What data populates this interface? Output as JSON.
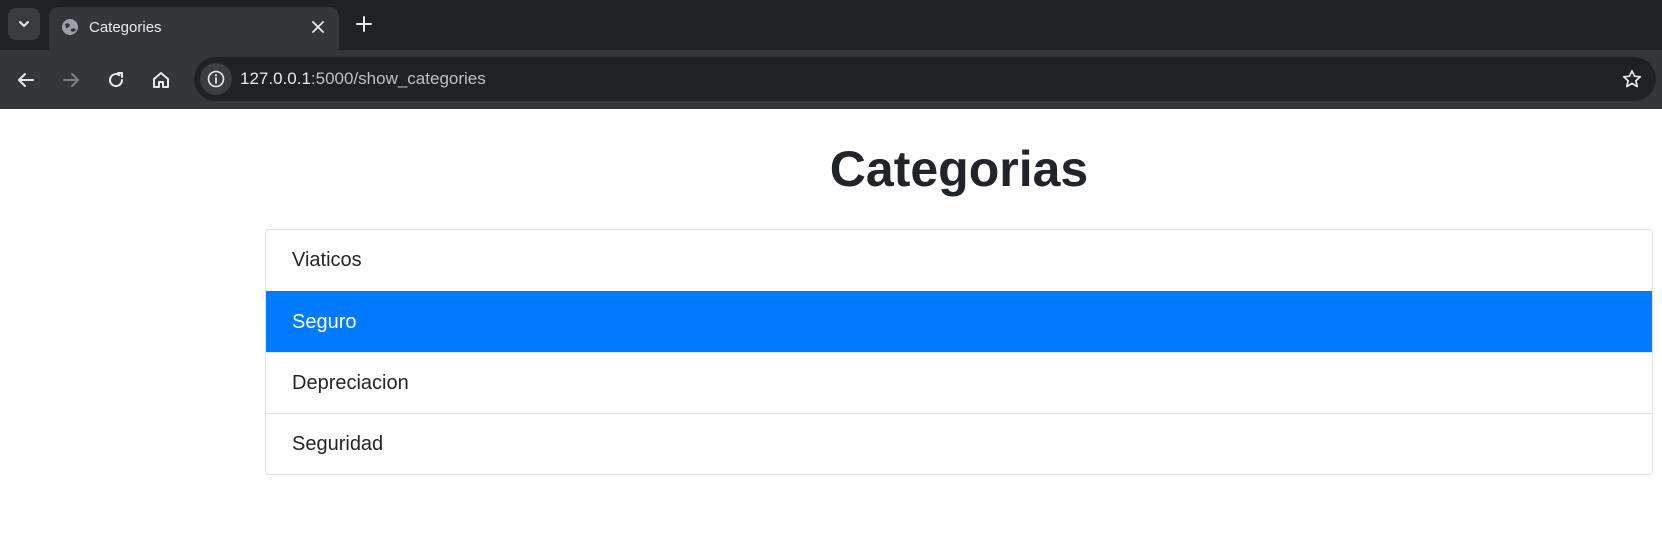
{
  "browser": {
    "tab": {
      "title": "Categories"
    },
    "address_bar": {
      "host": "127.0.0.1",
      "rest": ":5000/show_categories"
    },
    "icons": [
      "chevron-down-icon",
      "globe-icon",
      "close-icon",
      "plus-icon",
      "back-arrow-icon",
      "forward-arrow-icon",
      "reload-icon",
      "home-icon",
      "info-icon",
      "star-icon"
    ]
  },
  "page": {
    "title": "Categorias",
    "categories": [
      {
        "label": "Viaticos",
        "active": false
      },
      {
        "label": "Seguro",
        "active": true
      },
      {
        "label": "Depreciacion",
        "active": false
      },
      {
        "label": "Seguridad",
        "active": false
      }
    ]
  },
  "colors": {
    "active_item": "#007bff",
    "chrome_dark": "#202124",
    "chrome_toolbar": "#35363a"
  }
}
